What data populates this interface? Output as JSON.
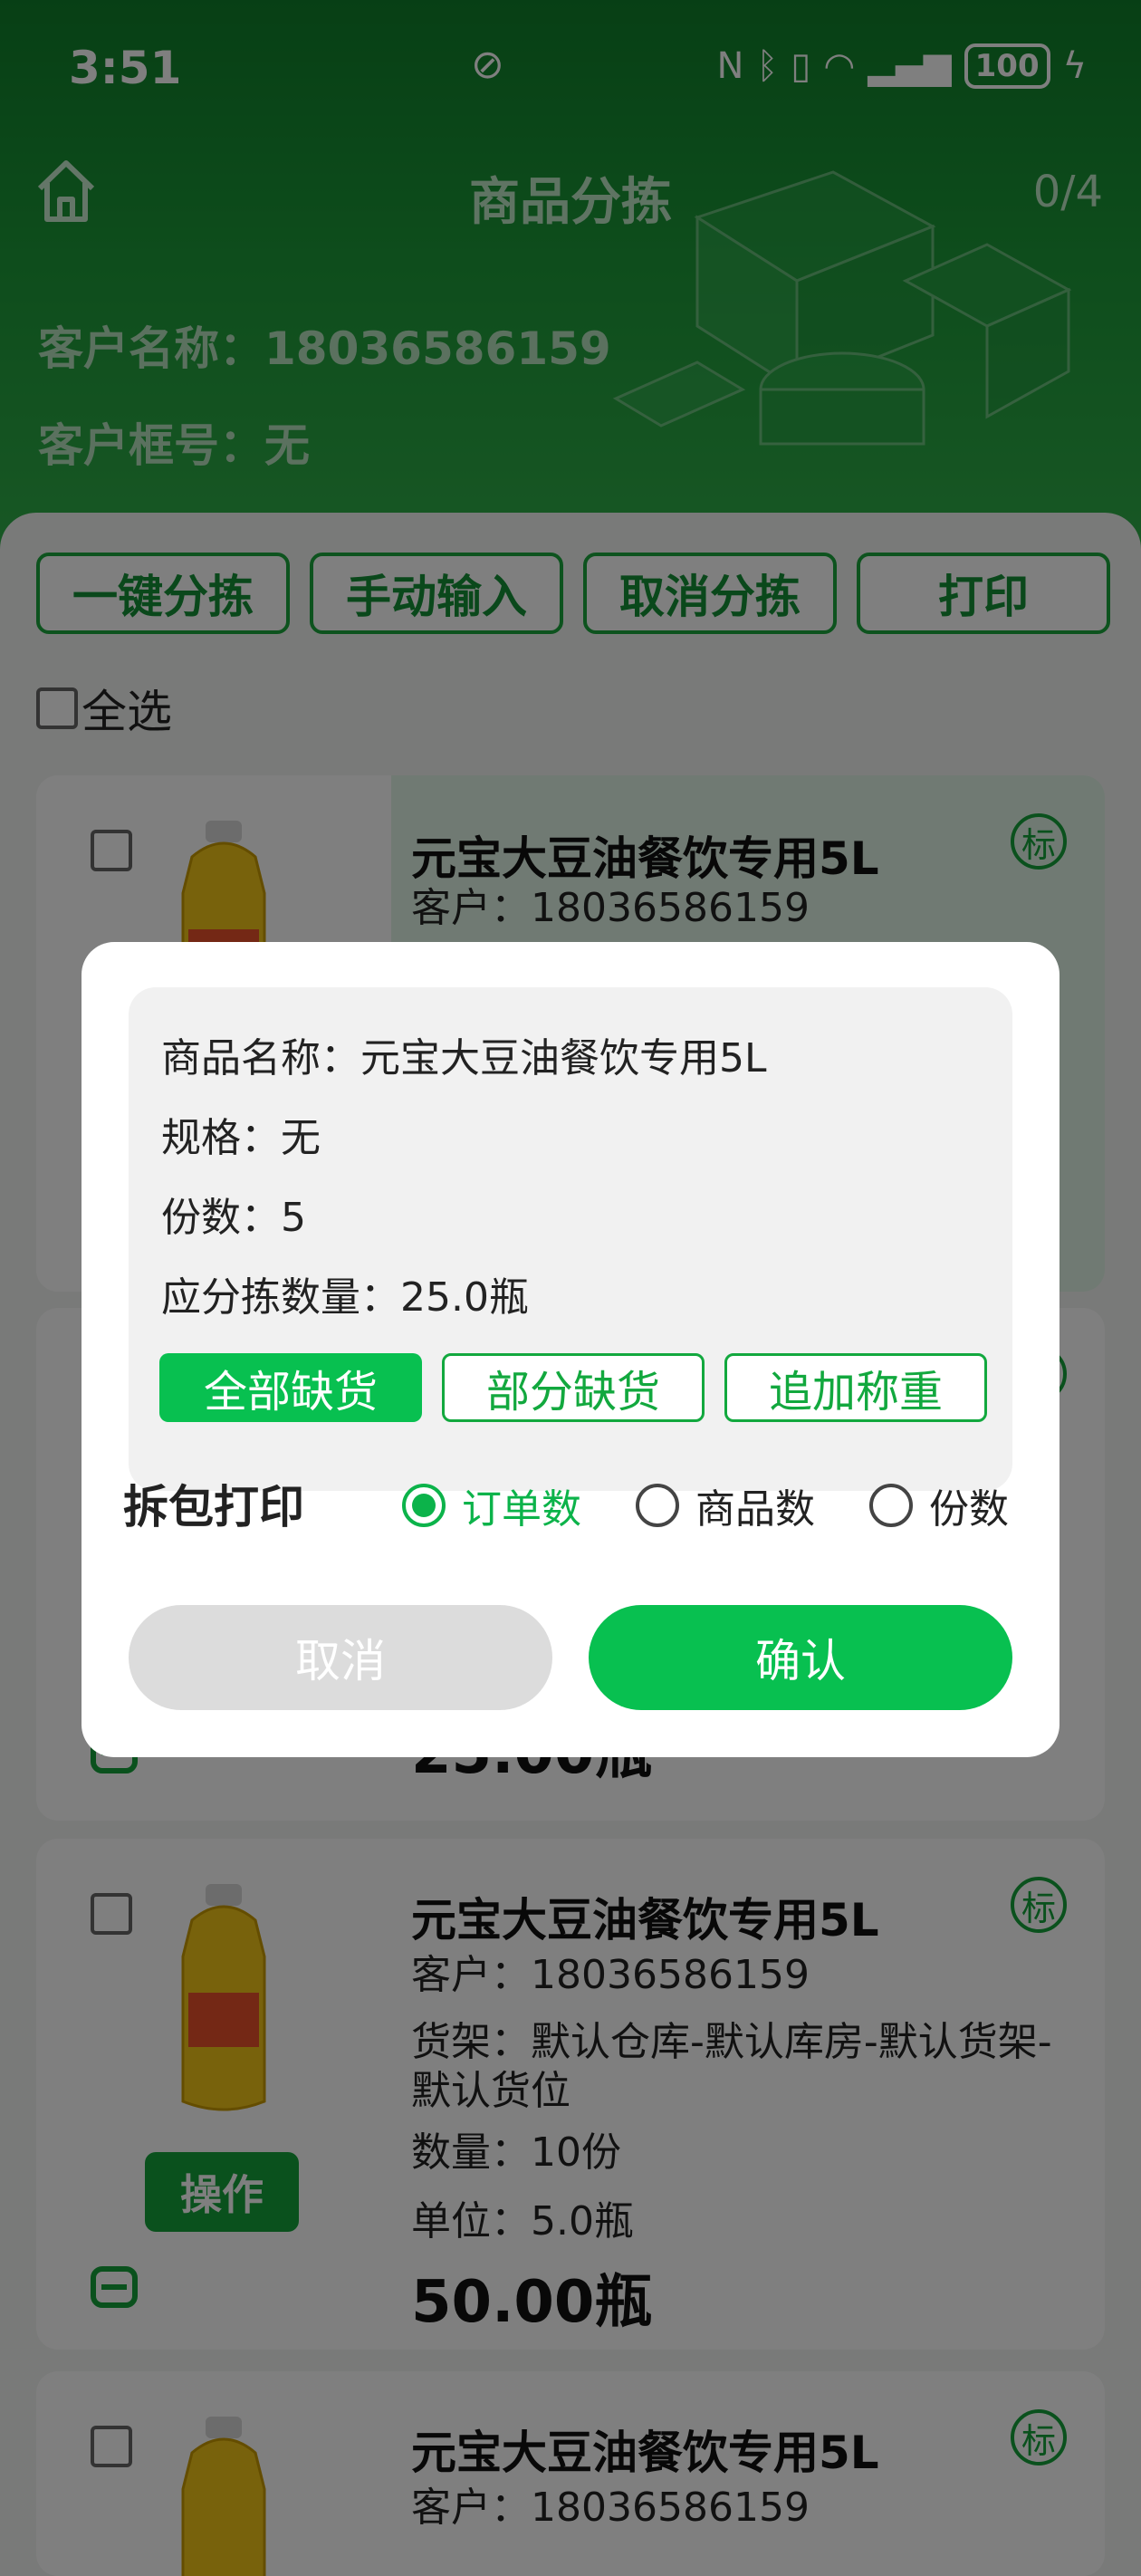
{
  "status_bar": {
    "time": "3:51",
    "battery": "100"
  },
  "header": {
    "title": "商品分拣",
    "count": "0/4",
    "customer_name_line": "客户名称：18036586159",
    "customer_box_line": "客户框号：无"
  },
  "actions": {
    "one_click_sort": "一键分拣",
    "manual_input": "手动输入",
    "cancel_sort": "取消分拣",
    "print": "打印"
  },
  "select_all_label": "全选",
  "cards": [
    {
      "name": "元宝大豆油餐饮专用5L",
      "customer": "客户：18036586159",
      "tag": "标"
    },
    {
      "tag": "标",
      "total": "25.00瓶"
    },
    {
      "name": "元宝大豆油餐饮专用5L",
      "customer": "客户：18036586159",
      "shelf": "货架：默认仓库-默认库房-默认货架-默认货位",
      "quantity": "数量：10份",
      "unit": "单位：5.0瓶",
      "total": "50.00瓶",
      "op_label": "操作",
      "tag": "标"
    },
    {
      "name": "元宝大豆油餐饮专用5L",
      "customer": "客户：18036586159",
      "tag": "标"
    }
  ],
  "dialog": {
    "product_name": "商品名称：元宝大豆油餐饮专用5L",
    "spec": "规格：无",
    "portions": "份数：5",
    "should_sort_qty": "应分拣数量：25.0瓶",
    "btn_all_shortage": "全部缺货",
    "btn_partial_shortage": "部分缺货",
    "btn_add_weigh": "追加称重",
    "split_print_label": "拆包打印",
    "radio_options": [
      "订单数",
      "商品数",
      "份数"
    ],
    "radio_selected": "订单数",
    "cancel": "取消",
    "confirm": "确认"
  },
  "colors": {
    "brand_green": "#08c050",
    "header_green": "#1c9a38"
  }
}
